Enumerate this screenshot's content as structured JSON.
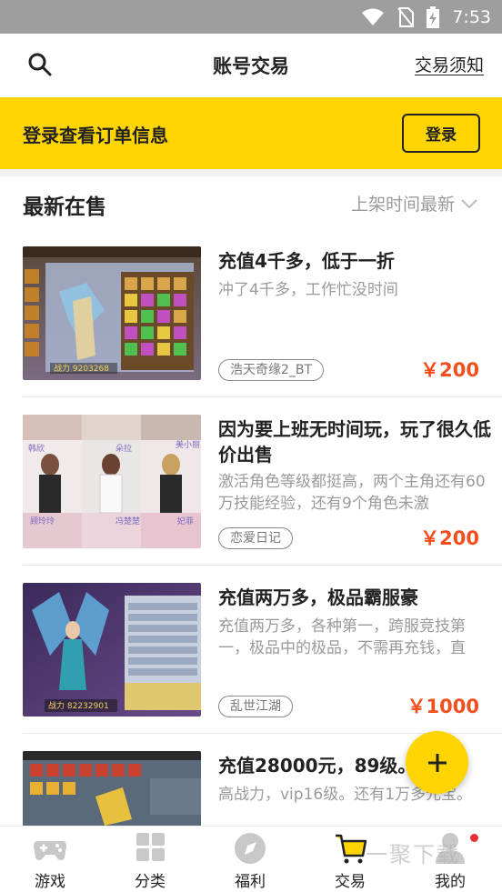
{
  "status_bar": {
    "time": "7:53"
  },
  "nav": {
    "title": "账号交易",
    "link": "交易须知"
  },
  "login_banner": {
    "text": "登录查看订单信息",
    "button": "登录"
  },
  "section": {
    "title": "最新在售",
    "sort": "上架时间最新"
  },
  "listings": [
    {
      "title": "充值4千多，低于一折",
      "desc": "冲了4千多，工作忙没时间",
      "game": "浩天奇缘2_BT",
      "price": "￥200"
    },
    {
      "title": "因为要上班无时间玩，玩了很久低价出售",
      "desc": "激活角色等级都挺高，两个主角还有60万技能经验，还有9个角色未激",
      "game": "恋爱日记",
      "price": "￥200"
    },
    {
      "title": "充值两万多，极品霸服豪",
      "desc": "充值两万多，各种第一，跨服竞技第一，极品中的极品，不需再充钱，直",
      "game": "乱世江湖",
      "price": "￥1000"
    },
    {
      "title": "充值28000元，89级。",
      "desc": "高战力，vip16级。还有1万多元宝。",
      "game": "",
      "price": ""
    }
  ],
  "thumb_texts": {
    "t1": "战力 9203268",
    "t2_names": [
      "韩欣",
      "朵拉",
      "美小丽",
      "顾玲玲",
      "冯楚楚",
      "妃菲"
    ],
    "t3": "战力 82232901"
  },
  "tabs": [
    {
      "label": "游戏",
      "icon": "gamepad-icon"
    },
    {
      "label": "分类",
      "icon": "grid-icon"
    },
    {
      "label": "福利",
      "icon": "compass-icon"
    },
    {
      "label": "交易",
      "icon": "cart-icon",
      "active": true
    },
    {
      "label": "我的",
      "icon": "user-icon"
    }
  ],
  "watermark": "一聚下载",
  "colors": {
    "accent": "#fed500",
    "price": "#f24e1e",
    "muted": "#9a9a9a"
  }
}
